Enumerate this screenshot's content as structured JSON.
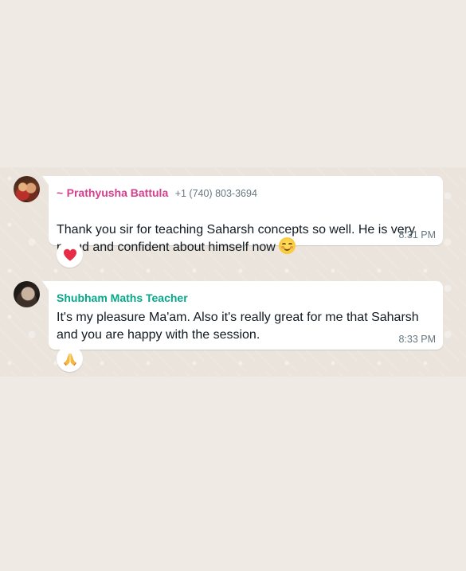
{
  "messages": [
    {
      "sender_prefix": "~",
      "sender_name": "Prathyusha Battula",
      "phone": "+1 (740) 803-3694",
      "text": "Thank you sir for teaching Saharsh concepts so well. He is very\nproud and confident about himself now",
      "time": "8:31 PM",
      "inline_emoji": "smiling-face-icon",
      "reaction": "red-heart-icon"
    },
    {
      "sender_name": "Shubham Maths Teacher",
      "text": "It's my pleasure Ma'am. Also it's really great for me that Saharsh\nand you are happy with the session.",
      "time": "8:33 PM",
      "reaction": "folded-hands-icon"
    }
  ],
  "colors": {
    "page_background": "#efebe4",
    "chat_background": "#eae4dc",
    "bubble_background": "#ffffff",
    "sender_1_name": "#d53f8c",
    "sender_2_name": "#06a88a",
    "meta_text": "#667781",
    "message_text": "#111b21"
  }
}
